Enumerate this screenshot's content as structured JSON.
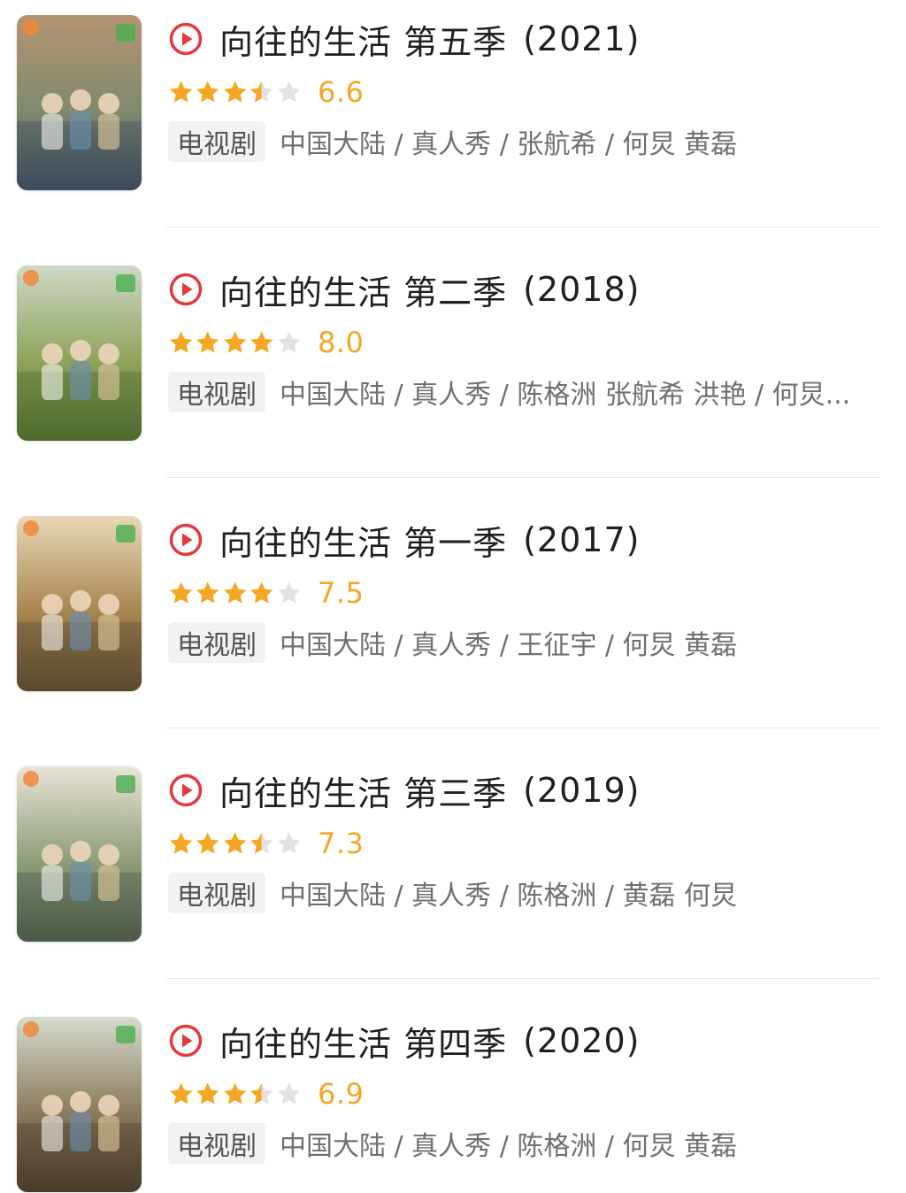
{
  "items": [
    {
      "title": "向往的生活 第五季",
      "year": "(2021)",
      "rating": 6.6,
      "stars": 3.5,
      "tag": "电视剧",
      "meta": "中国大陆 / 真人秀 / 张航希 / 何炅 黄磊",
      "poster_colors": [
        "#b59472",
        "#7f8a6e",
        "#3b4a5b"
      ]
    },
    {
      "title": "向往的生活 第二季",
      "year": "(2018)",
      "rating": 8.0,
      "stars": 4,
      "tag": "电视剧",
      "meta": "中国大陆 / 真人秀 / 陈格洲 张航希 洪艳 / 何炅...",
      "poster_colors": [
        "#cfd8c6",
        "#8fa35a",
        "#4d6b2e"
      ]
    },
    {
      "title": "向往的生活 第一季",
      "year": "(2017)",
      "rating": 7.5,
      "stars": 4,
      "tag": "电视剧",
      "meta": "中国大陆 / 真人秀 / 王征宇 / 何炅 黄磊",
      "poster_colors": [
        "#e8d8b8",
        "#a7864f",
        "#5a4930"
      ]
    },
    {
      "title": "向往的生活 第三季",
      "year": "(2019)",
      "rating": 7.3,
      "stars": 3.5,
      "tag": "电视剧",
      "meta": "中国大陆 / 真人秀 / 陈格洲 / 黄磊 何炅",
      "poster_colors": [
        "#e9e4d7",
        "#8d9c78",
        "#4c5a48"
      ]
    },
    {
      "title": "向往的生活 第四季",
      "year": "(2020)",
      "rating": 6.9,
      "stars": 3.5,
      "tag": "电视剧",
      "meta": "中国大陆 / 真人秀 / 陈格洲 / 何炅 黄磊",
      "poster_colors": [
        "#d6dccf",
        "#8a7a5c",
        "#4b3b2b"
      ]
    }
  ],
  "colors": {
    "accent_red": "#e4393c",
    "star_filled": "#f5a623",
    "star_empty": "#e2e2e2"
  }
}
